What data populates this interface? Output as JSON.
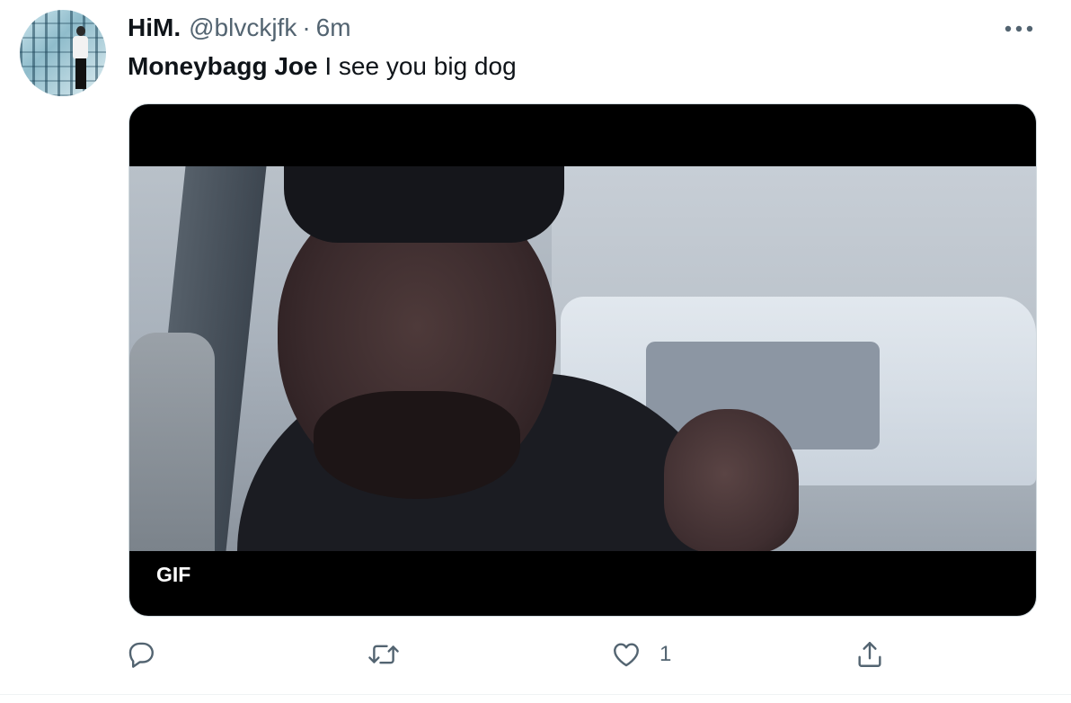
{
  "tweet": {
    "author": {
      "display_name": "HiM.",
      "handle": "@blvckjfk",
      "separator": "·",
      "time": "6m"
    },
    "text": {
      "mention": "Moneybagg Joe",
      "body": " I see you big dog"
    },
    "media": {
      "badge": "GIF"
    },
    "actions": {
      "reply_icon": "reply-icon",
      "retweet_icon": "retweet-icon",
      "like_icon": "heart-icon",
      "like_count": "1",
      "share_icon": "share-icon"
    },
    "more_icon": "more-icon"
  }
}
